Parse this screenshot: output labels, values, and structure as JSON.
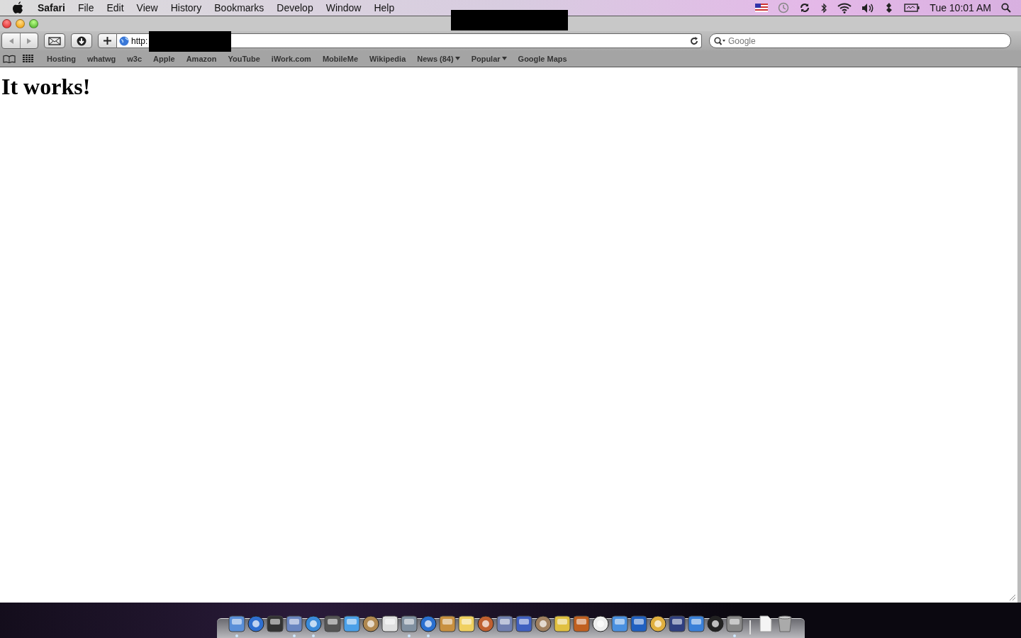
{
  "menu_bar": {
    "app": "Safari",
    "menus": [
      "File",
      "Edit",
      "View",
      "History",
      "Bookmarks",
      "Develop",
      "Window",
      "Help"
    ],
    "clock": "Tue 10:01 AM"
  },
  "toolbar": {
    "url": "http:",
    "search_placeholder": "Google"
  },
  "bookmarks": [
    {
      "label": "Hosting",
      "menu": false
    },
    {
      "label": "whatwg",
      "menu": false
    },
    {
      "label": "w3c",
      "menu": false
    },
    {
      "label": "Apple",
      "menu": false
    },
    {
      "label": "Amazon",
      "menu": false
    },
    {
      "label": "YouTube",
      "menu": false
    },
    {
      "label": "iWork.com",
      "menu": false
    },
    {
      "label": "MobileMe",
      "menu": false
    },
    {
      "label": "Wikipedia",
      "menu": false
    },
    {
      "label": "News (84)",
      "menu": true
    },
    {
      "label": "Popular",
      "menu": true
    },
    {
      "label": "Google Maps",
      "menu": false
    }
  ],
  "page": {
    "heading": "It works!"
  },
  "dock": {
    "apps": [
      {
        "running": true
      },
      {
        "running": false
      },
      {
        "running": false
      },
      {
        "running": true
      },
      {
        "running": true
      },
      {
        "running": false
      },
      {
        "running": false
      },
      {
        "running": false
      },
      {
        "running": false
      },
      {
        "running": true
      },
      {
        "running": true
      },
      {
        "running": false
      },
      {
        "running": false
      },
      {
        "running": false
      },
      {
        "running": false
      },
      {
        "running": false
      },
      {
        "running": false
      },
      {
        "running": false
      },
      {
        "running": false
      },
      {
        "running": false
      },
      {
        "running": false
      },
      {
        "running": false
      },
      {
        "running": false
      },
      {
        "running": false
      },
      {
        "running": false
      },
      {
        "running": false
      },
      {
        "running": true
      }
    ],
    "documents": [
      {
        "running": false
      },
      {
        "running": false
      }
    ]
  }
}
